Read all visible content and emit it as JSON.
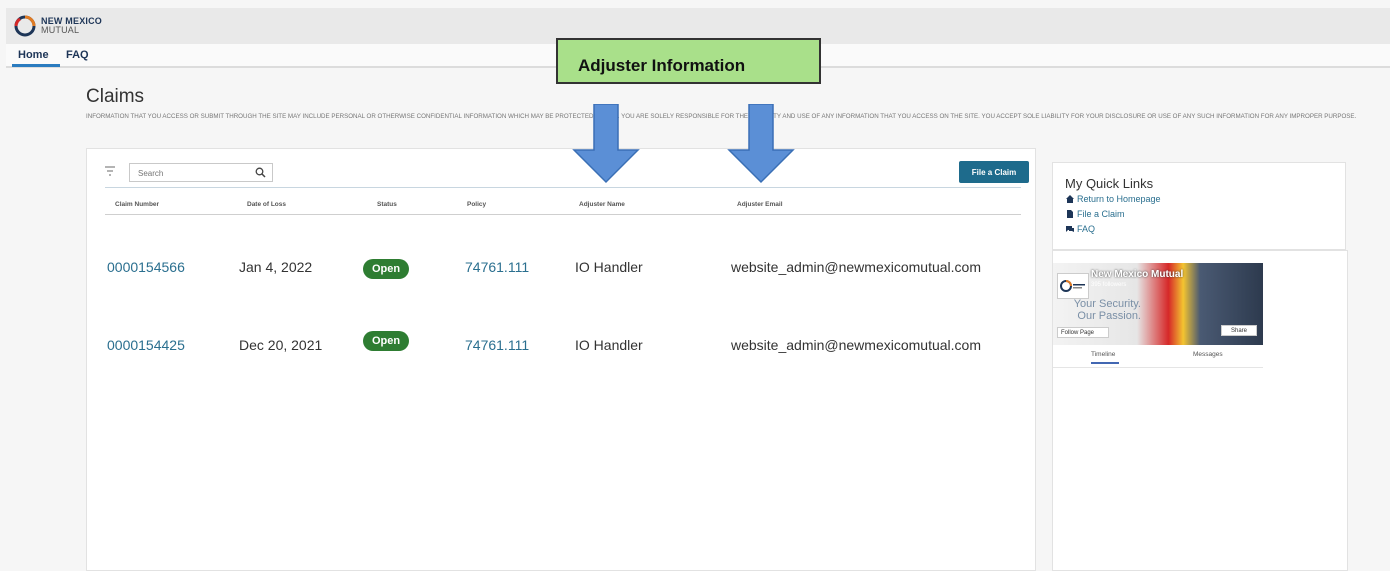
{
  "brand": {
    "line1": "NEW MEXICO",
    "line2": "MUTUAL"
  },
  "nav": {
    "home": "Home",
    "faq": "FAQ"
  },
  "page": {
    "title": "Claims",
    "disclaimer": "INFORMATION THAT YOU ACCESS OR SUBMIT THROUGH THE SITE MAY INCLUDE PERSONAL OR OTHERWISE CONFIDENTIAL INFORMATION WHICH MAY BE PROTECTED BY LAW. YOU ARE SOLELY RESPONSIBLE FOR THE SECURITY AND USE OF ANY INFORMATION THAT YOU ACCESS ON THE SITE. YOU ACCEPT SOLE LIABILITY FOR YOUR DISCLOSURE OR USE OF ANY SUCH INFORMATION FOR ANY IMPROPER PURPOSE."
  },
  "toolbar": {
    "search_placeholder": "Search",
    "file_claim_label": "File a Claim"
  },
  "table": {
    "columns": [
      "Claim Number",
      "Date of Loss",
      "Status",
      "Policy",
      "Adjuster Name",
      "Adjuster Email"
    ],
    "rows": [
      {
        "claim_number": "0000154566",
        "date_of_loss": "Jan 4, 2022",
        "status": "Open",
        "policy": "74761.111",
        "adjuster_name": "IO Handler",
        "adjuster_email": "website_admin@newmexicomutual.com"
      },
      {
        "claim_number": "0000154425",
        "date_of_loss": "Dec 20, 2021",
        "status": "Open",
        "policy": "74761.111",
        "adjuster_name": "IO Handler",
        "adjuster_email": "website_admin@newmexicomutual.com"
      }
    ]
  },
  "quick_links": {
    "title": "My Quick Links",
    "items": [
      {
        "label": "Return to Homepage",
        "icon": "home-icon"
      },
      {
        "label": "File a Claim",
        "icon": "document-icon"
      },
      {
        "label": "FAQ",
        "icon": "chat-icon"
      }
    ]
  },
  "facebook": {
    "page_name": "New Mexico Mutual",
    "followers": "395 followers",
    "tagline_1": "Your Security.",
    "tagline_2": "Our Passion.",
    "follow_label": "Follow Page",
    "share_label": "Share",
    "tab_timeline": "Timeline",
    "tab_messages": "Messages"
  },
  "annotation": {
    "callout_text": "Adjuster Information"
  },
  "colors": {
    "accent": "#1e6b8c",
    "status_open": "#2e7d32",
    "callout_bg": "#a9e08a",
    "arrow": "#5b8fd6"
  }
}
